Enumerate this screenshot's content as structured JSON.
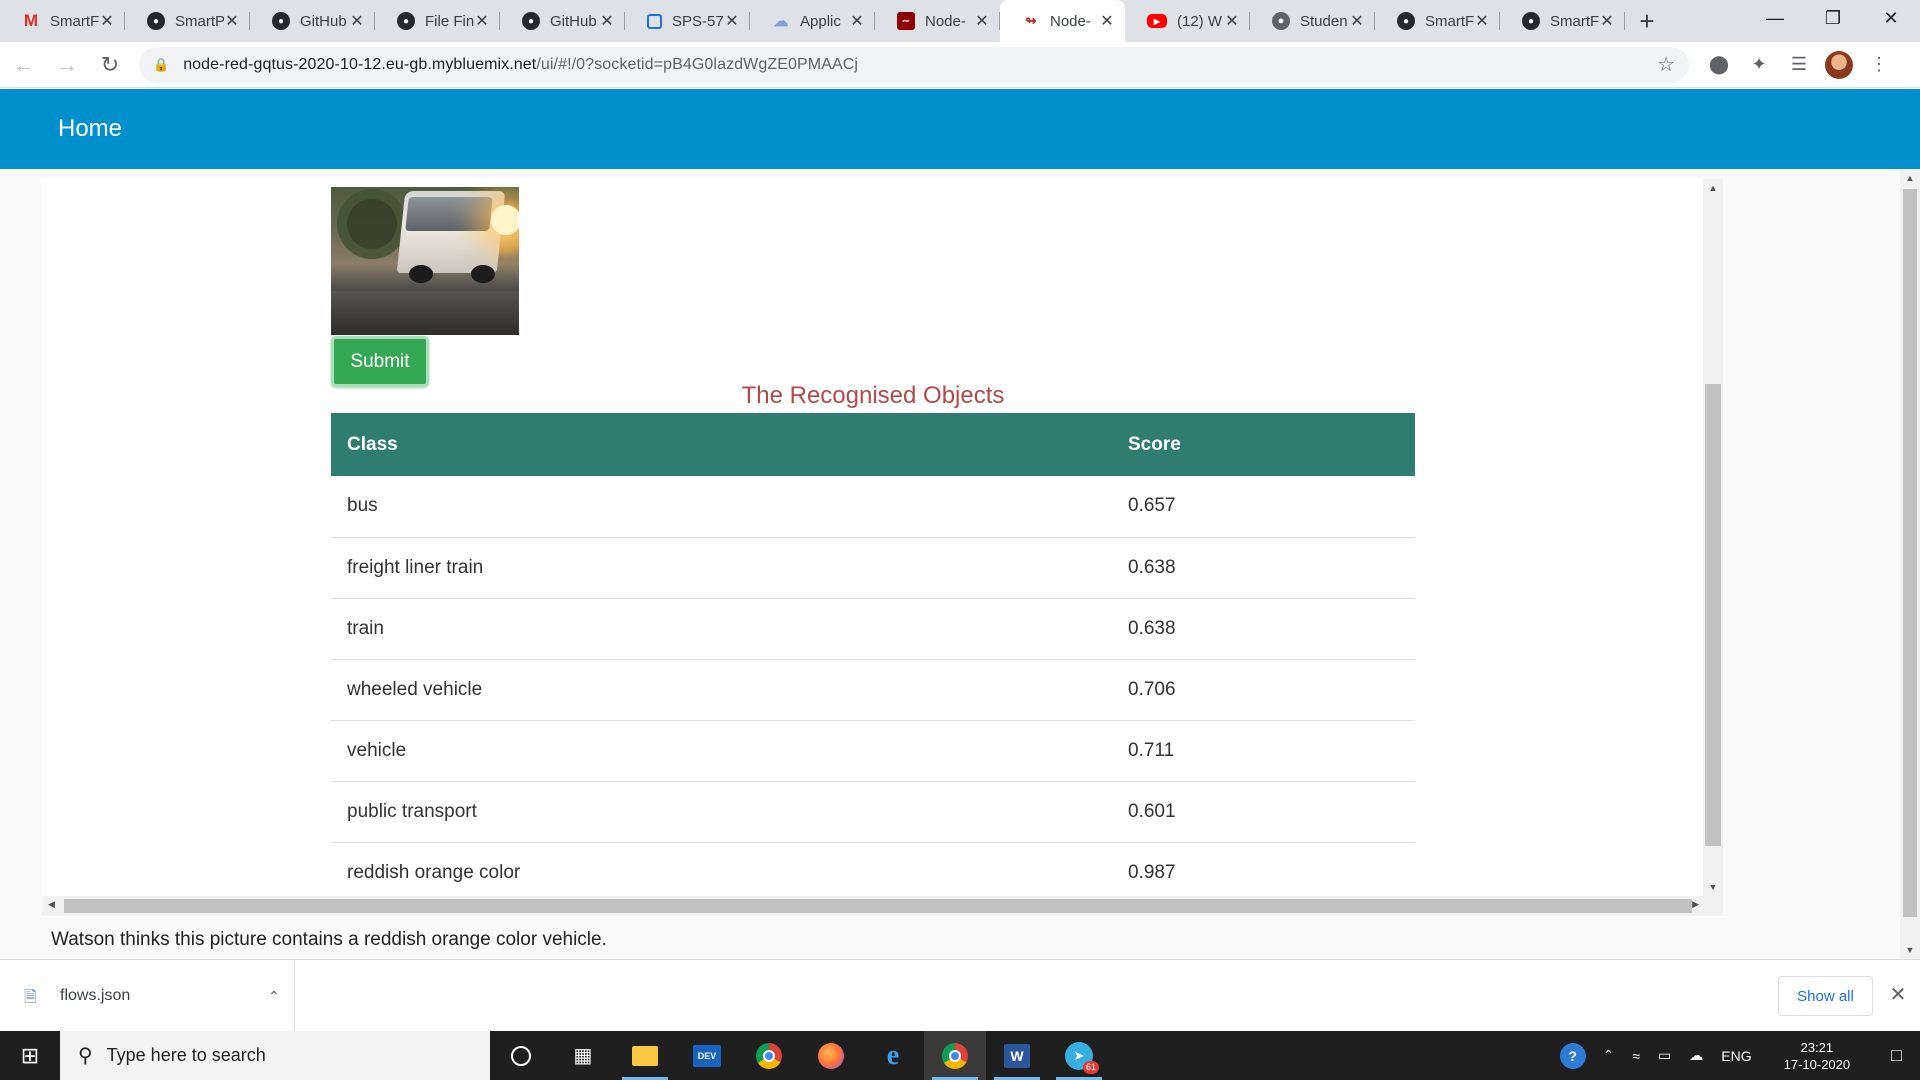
{
  "browser": {
    "tabs": [
      {
        "title": "SmartF",
        "icon": "gmail-icon",
        "active": false
      },
      {
        "title": "SmartP",
        "icon": "github-icon",
        "active": false
      },
      {
        "title": "GitHub",
        "icon": "github-icon",
        "active": false
      },
      {
        "title": "File Fin",
        "icon": "github-icon",
        "active": false
      },
      {
        "title": "GitHub",
        "icon": "github-icon",
        "active": false
      },
      {
        "title": "SPS-57",
        "icon": "document-icon",
        "active": false
      },
      {
        "title": "Applic",
        "icon": "cloud-icon",
        "active": false
      },
      {
        "title": "Node-",
        "icon": "node-red-icon",
        "active": false
      },
      {
        "title": "Node-",
        "icon": "node-red-flow-icon",
        "active": true
      },
      {
        "title": "(12) W",
        "icon": "youtube-icon",
        "active": false
      },
      {
        "title": "Studen",
        "icon": "globe-icon",
        "active": false
      },
      {
        "title": "SmartF",
        "icon": "github-icon",
        "active": false
      },
      {
        "title": "SmartF",
        "icon": "github-icon",
        "active": false
      }
    ],
    "url_host": "node-red-gqtus-2020-10-12.eu-gb.mybluemix.net",
    "url_path": "/ui/#!/0?socketid=pB4G0lazdWgZE0PMAACj"
  },
  "dashboard": {
    "title": "Home",
    "header_color": "#0091cc"
  },
  "main": {
    "submit_label": "Submit",
    "section_title": "The Recognised Objects",
    "table": {
      "headers": [
        "Class",
        "Score"
      ],
      "rows": [
        [
          "bus",
          "0.657"
        ],
        [
          "freight liner train",
          "0.638"
        ],
        [
          "train",
          "0.638"
        ],
        [
          "wheeled vehicle",
          "0.706"
        ],
        [
          "vehicle",
          "0.711"
        ],
        [
          "public transport",
          "0.601"
        ],
        [
          "reddish orange color",
          "0.987"
        ]
      ]
    },
    "watson_text": "Watson thinks this picture contains a reddish orange color vehicle."
  },
  "downloads": {
    "file_name": "flows.json",
    "show_all_label": "Show all"
  },
  "taskbar": {
    "search_placeholder": "Type here to search",
    "language": "ENG",
    "time": "23:21",
    "date": "17-10-2020",
    "telegram_badge": "61"
  },
  "colors": {
    "table_header": "#2e7d70",
    "section_title": "#b34a4a",
    "submit_button": "#34a853"
  }
}
